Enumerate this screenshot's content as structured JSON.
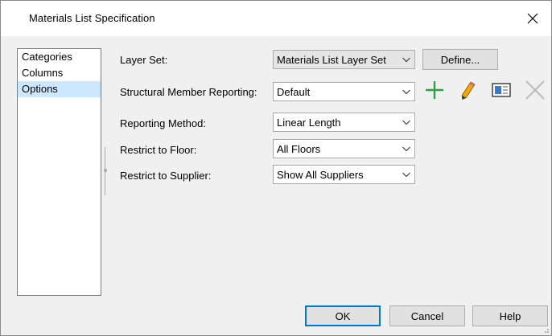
{
  "window": {
    "title": "Materials List Specification",
    "close_icon": "close-icon"
  },
  "sidebar": {
    "items": [
      {
        "label": "Categories",
        "selected": false
      },
      {
        "label": "Columns",
        "selected": false
      },
      {
        "label": "Options",
        "selected": true
      }
    ]
  },
  "form": {
    "layer_set": {
      "label": "Layer Set:",
      "value": "Materials List Layer Set",
      "define_label": "Define..."
    },
    "structural_member": {
      "label": "Structural Member Reporting:",
      "value": "Default",
      "icons": [
        "add-icon",
        "edit-pencil-icon",
        "properties-icon",
        "delete-icon"
      ]
    },
    "reporting_method": {
      "label": "Reporting Method:",
      "value": "Linear Length"
    },
    "restrict_floor": {
      "label": "Restrict to Floor:",
      "value": "All Floors"
    },
    "restrict_supplier": {
      "label": "Restrict to Supplier:",
      "value": "Show All Suppliers"
    }
  },
  "footer": {
    "ok_label": "OK",
    "cancel_label": "Cancel",
    "help_label": "Help"
  },
  "colors": {
    "accent": "#0078d7",
    "selection": "#cce8ff",
    "add_icon": "#2ea043",
    "pencil_icon": "#f2a900",
    "disabled_icon": "#bdbdbd"
  }
}
